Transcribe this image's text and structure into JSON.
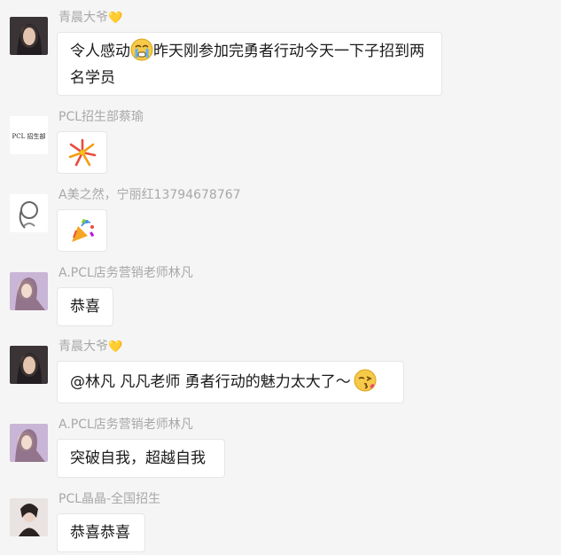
{
  "messages": [
    {
      "sender": "青晨大爷",
      "heart": "💛",
      "text_a": "令人感动",
      "emoji": "crying-face",
      "text_b": "昨天刚参加完勇者行动今天一下子招到两名学员"
    },
    {
      "sender": "PCL招生部蔡瑜",
      "sticker": "fireworks-sticker",
      "avatar_text": "PCL 招生部"
    },
    {
      "sender": "A美之然，宁丽红13794678767",
      "sticker": "party-popper-sticker"
    },
    {
      "sender": "A.PCL店务营销老师林凡",
      "text": "恭喜"
    },
    {
      "sender": "青晨大爷",
      "heart": "💛",
      "text": "@林凡 凡凡老师 勇者行动的魅力太大了～",
      "emoji": "kissing-face"
    },
    {
      "sender": "A.PCL店务营销老师林凡",
      "text": "突破自我，超越自我"
    },
    {
      "sender": "PCL晶晶-全国招生",
      "text": "恭喜恭喜"
    }
  ]
}
